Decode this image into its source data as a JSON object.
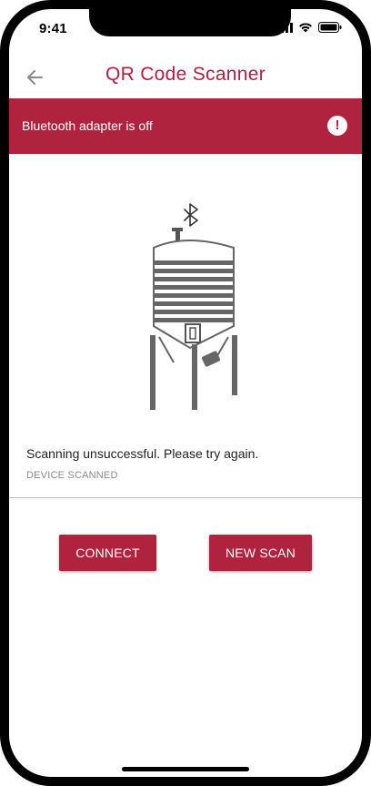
{
  "status_bar": {
    "time": "9:41",
    "icons": [
      "signal-icon",
      "wifi-icon",
      "battery-icon"
    ]
  },
  "header": {
    "back_icon": "arrow-left-icon",
    "title": "QR Code Scanner"
  },
  "banner": {
    "message": "Bluetooth adapter is off",
    "icon": "alert-circle-icon",
    "color": "#b0233f"
  },
  "illustration": {
    "icons": [
      "bluetooth-icon",
      "silo-tank-icon"
    ]
  },
  "result": {
    "message": "Scanning unsuccessful. Please try again.",
    "sublabel": "DEVICE SCANNED"
  },
  "actions": {
    "connect_label": "CONNECT",
    "new_scan_label": "NEW SCAN"
  },
  "colors": {
    "accent": "#b1213f",
    "banner": "#b0233f",
    "button": "#b0233f"
  }
}
